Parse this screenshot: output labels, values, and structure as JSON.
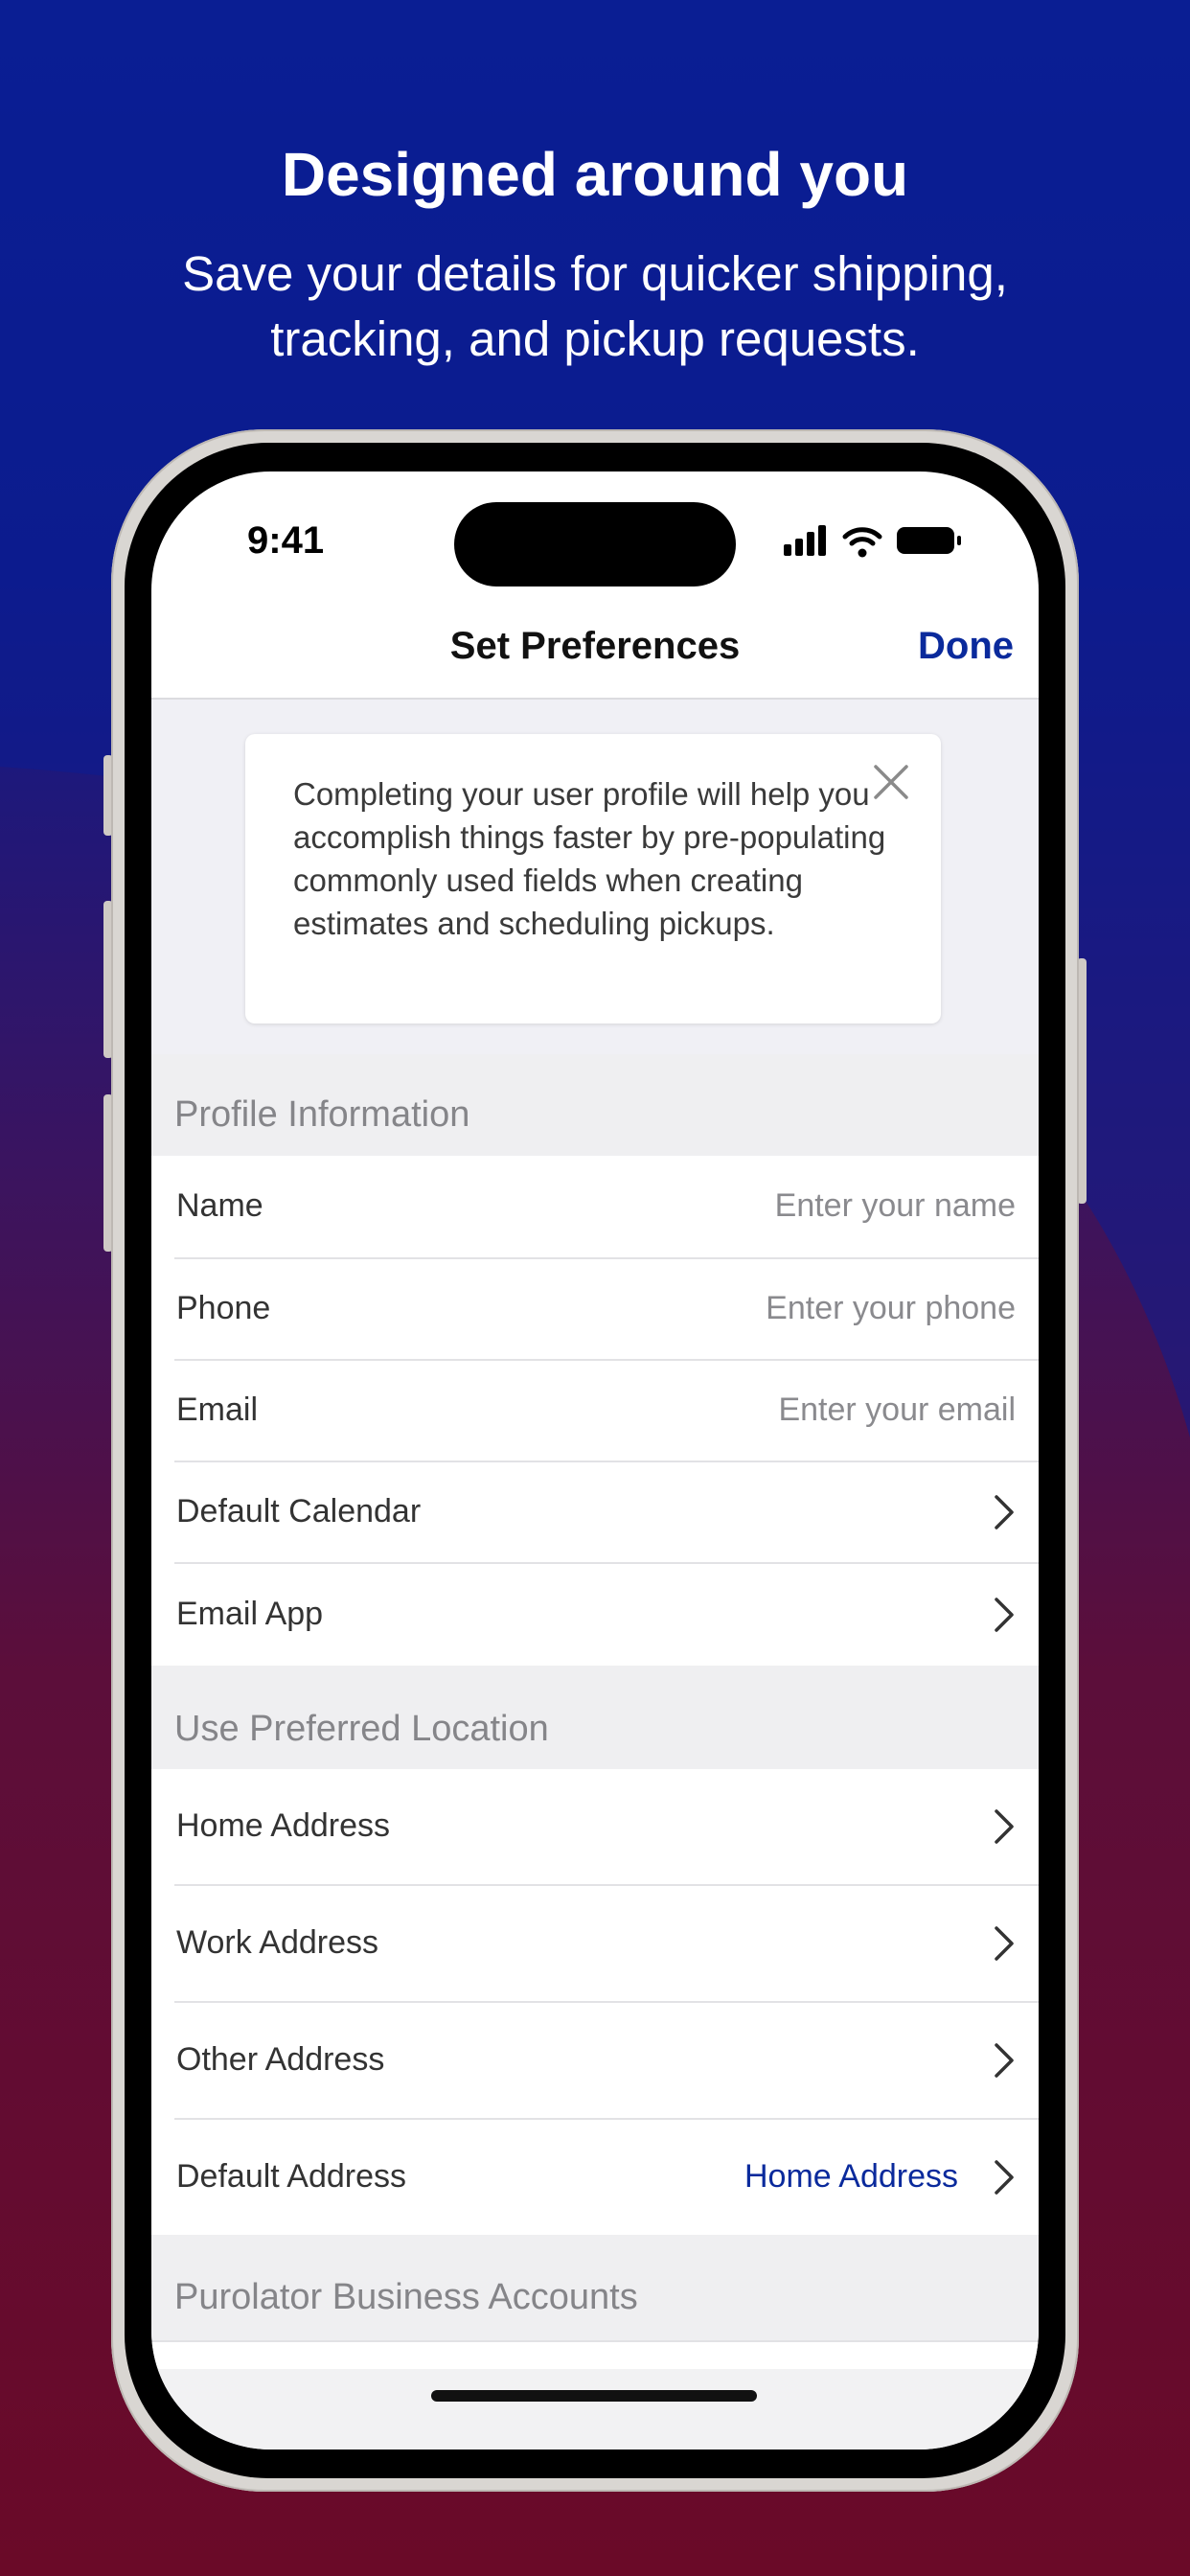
{
  "marketing": {
    "headline": "Designed around you",
    "subhead": "Save your details for quicker shipping, tracking, and pickup requests."
  },
  "status_bar": {
    "time": "9:41",
    "icons": [
      "signal-icon",
      "wifi-icon",
      "battery-icon"
    ]
  },
  "nav": {
    "title": "Set Preferences",
    "done_label": "Done"
  },
  "tip": {
    "text": "Completing your user profile will help you accomplish things faster by pre-populating commonly used fields when creating estimates and scheduling pickups.",
    "close_icon": "close-icon"
  },
  "sections": {
    "profile": {
      "title": "Profile Information",
      "rows": [
        {
          "label": "Name",
          "placeholder": "Enter your name"
        },
        {
          "label": "Phone",
          "placeholder": "Enter your phone"
        },
        {
          "label": "Email",
          "placeholder": "Enter your email"
        },
        {
          "label": "Default Calendar"
        },
        {
          "label": "Email App"
        }
      ]
    },
    "location": {
      "title": "Use Preferred Location",
      "rows": [
        {
          "label": "Home Address"
        },
        {
          "label": "Work Address"
        },
        {
          "label": "Other Address"
        },
        {
          "label": "Default Address",
          "value": "Home Address"
        }
      ]
    },
    "business": {
      "title": "Purolator Business Accounts"
    }
  },
  "colors": {
    "accent": "#0a2a9c",
    "background_top": "#0a1f96",
    "background_bottom": "#6a0a28"
  }
}
